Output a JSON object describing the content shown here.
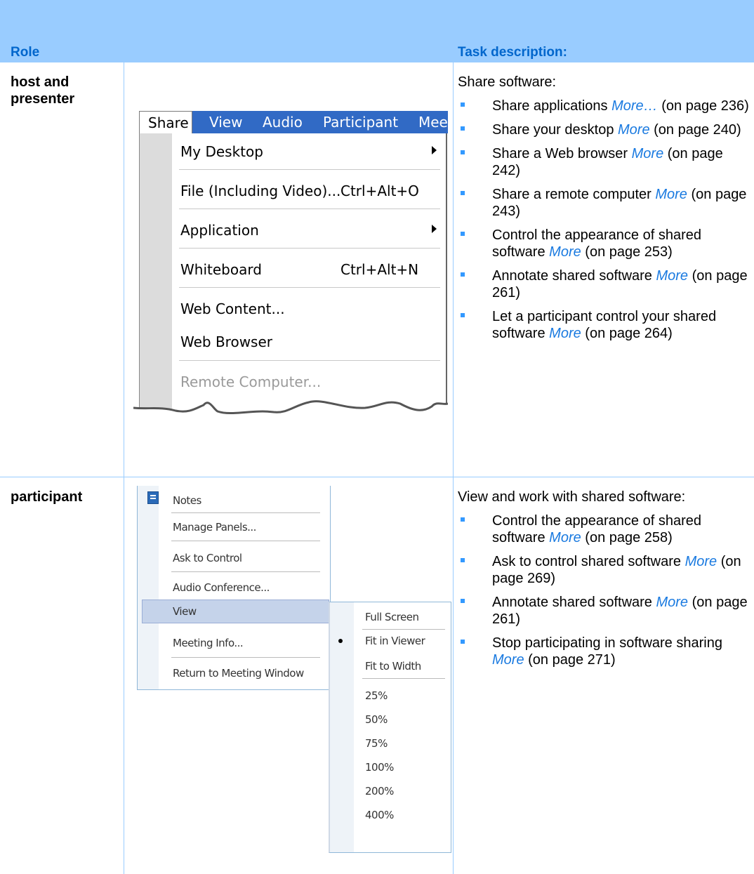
{
  "header": {
    "role": "Role",
    "task": "Task description:"
  },
  "rows": [
    {
      "role": "host and presenter",
      "intro": "Share software:",
      "items": [
        {
          "text": "Share applications ",
          "more": "More…",
          "page": " (on page 236)"
        },
        {
          "text": "Share your desktop ",
          "more": "More",
          "page": " (on page 240)"
        },
        {
          "text": "Share a Web browser ",
          "more": "More",
          "page": " (on page 242)"
        },
        {
          "text": "Share a remote computer  ",
          "more": "More",
          "page": " (on page 243)"
        },
        {
          "text": "Control the appearance of shared software ",
          "more": "More",
          "page": " (on page 253)"
        },
        {
          "text": "Annotate shared software ",
          "more": "More",
          "page": " (on page 261)"
        },
        {
          "text": "Let a participant control your shared software ",
          "more": "More",
          "page": " (on page 264)"
        }
      ]
    },
    {
      "role": "participant",
      "intro": "View and work with shared software:",
      "items": [
        {
          "text": "Control the appearance of shared software ",
          "more": "More",
          "page": " (on page 258)"
        },
        {
          "text": "Ask to control shared software ",
          "more": "More",
          "page": " (on page 269)"
        },
        {
          "text": "Annotate shared software ",
          "more": "More",
          "page": " (on page 261)"
        },
        {
          "text": "Stop participating in software sharing ",
          "more": "More",
          "page": " (on page 271)"
        }
      ]
    }
  ],
  "share_screenshot": {
    "menubar": [
      "Share",
      "View",
      "Audio",
      "Participant",
      "Mee"
    ],
    "items": [
      {
        "label": "My Desktop",
        "shortcut": "",
        "submenu": true,
        "disabled": false
      },
      {
        "label": "File (Including Video)...",
        "shortcut": "Ctrl+Alt+O",
        "submenu": false,
        "disabled": false
      },
      {
        "label": "Application",
        "shortcut": "",
        "submenu": true,
        "disabled": false
      },
      {
        "label": "Whiteboard",
        "shortcut": "Ctrl+Alt+N",
        "submenu": false,
        "disabled": false
      },
      {
        "label": "Web Content...",
        "shortcut": "",
        "submenu": false,
        "disabled": false
      },
      {
        "label": "Web Browser",
        "shortcut": "",
        "submenu": false,
        "disabled": false
      },
      {
        "label": "Remote Computer...",
        "shortcut": "",
        "submenu": false,
        "disabled": true
      }
    ]
  },
  "participant_screenshot": {
    "menu": [
      "Notes",
      "Manage Panels...",
      "Ask to Control",
      "Audio Conference...",
      "View",
      "Meeting Info...",
      "Return to Meeting Window"
    ],
    "submenu": [
      "Full Screen",
      "Fit in Viewer",
      "Fit to Width",
      "25%",
      "50%",
      "75%",
      "100%",
      "200%",
      "400%"
    ]
  },
  "colors": {
    "header_bg": "#99ccff",
    "header_text": "#0066cc",
    "link": "#1a7ae0",
    "bullet": "#3399ff",
    "menubar": "#316ac5"
  }
}
